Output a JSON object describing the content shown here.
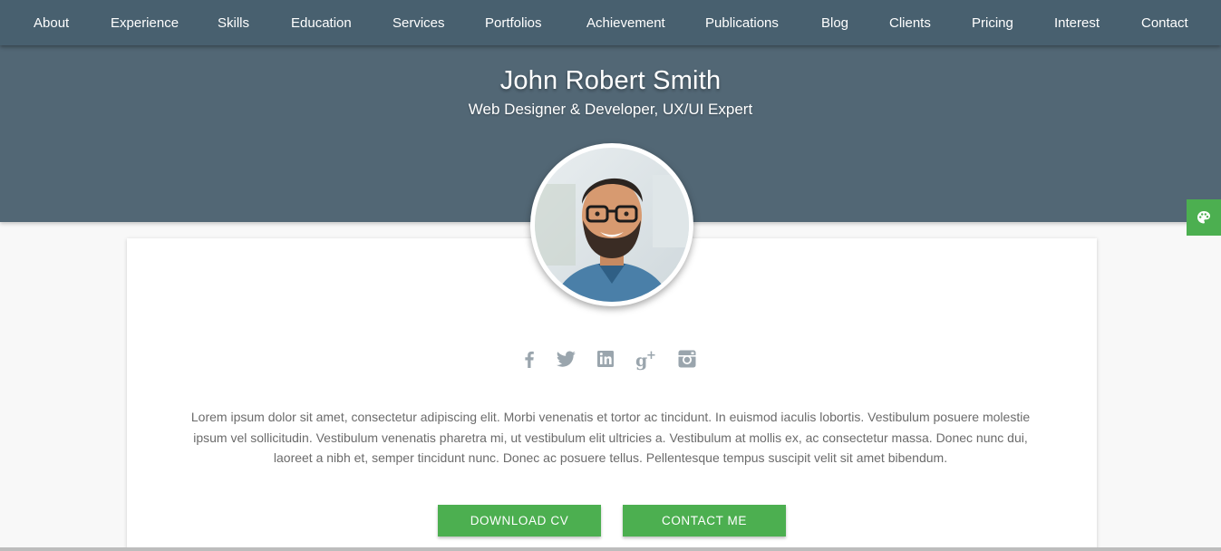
{
  "nav": {
    "items": [
      {
        "label": "About"
      },
      {
        "label": "Experience"
      },
      {
        "label": "Skills"
      },
      {
        "label": "Education"
      },
      {
        "label": "Services"
      },
      {
        "label": "Portfolios"
      },
      {
        "label": "Achievement"
      },
      {
        "label": "Publications"
      },
      {
        "label": "Blog"
      },
      {
        "label": "Clients"
      },
      {
        "label": "Pricing"
      },
      {
        "label": "Interest"
      },
      {
        "label": "Contact"
      }
    ]
  },
  "hero": {
    "name": "John Robert Smith",
    "tagline": "Web Designer & Developer, UX/UI Expert"
  },
  "social": {
    "icons": [
      "facebook-icon",
      "twitter-icon",
      "linkedin-icon",
      "google-plus-icon",
      "instagram-icon"
    ]
  },
  "bio": {
    "text": "Lorem ipsum dolor sit amet, consectetur adipiscing elit. Morbi venenatis et tortor ac tincidunt. In euismod iaculis lobortis. Vestibulum posuere molestie ipsum vel sollicitudin. Vestibulum venenatis pharetra mi, ut vestibulum elit ultricies a. Vestibulum at mollis ex, ac consectetur massa. Donec nunc dui, laoreet a nibh et, semper tincidunt nunc. Donec ac posuere tellus. Pellentesque tempus suscipit velit sit amet bibendum."
  },
  "buttons": {
    "download_cv": "DOWNLOAD CV",
    "contact_me": "CONTACT ME"
  },
  "colors": {
    "nav_bg": "#48606f",
    "hero_bg": "#526775",
    "accent": "#4caf50",
    "icon_gray": "#9aa5ad"
  }
}
